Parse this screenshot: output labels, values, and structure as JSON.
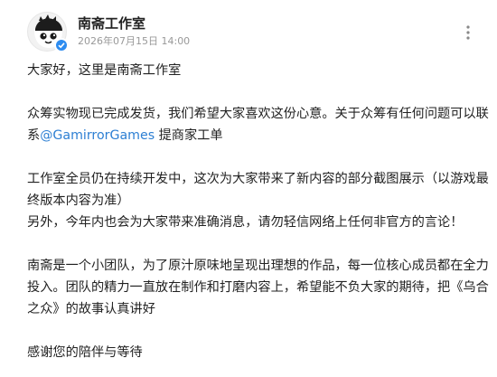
{
  "post": {
    "author": "南斋工作室",
    "date": "2026年07月15日 14:00",
    "greeting": "大家好，这里是南斋工作室",
    "p2_before": "众筹实物现已完成发货，我们希望大家喜欢这份心意。关于众筹有任何问题可以联系",
    "p2_mention": "@GamirrorGames",
    "p2_after": " 提商家工单",
    "p3_line1": "工作室全员仍在持续开发中，这次为大家带来了新内容的部分截图展示（以游戏最终版本内容为准）",
    "p3_line2": "另外，今年内也会为大家带来准确消息，请勿轻信网络上任何非官方的言论！",
    "p4": "南斋是一个小团队，为了原汁原味地呈现出理想的作品，每一位核心成员都在全力投入。团队的精力一直放在制作和打磨内容上，希望能不负大家的期待，把《乌合之众》的故事认真讲好",
    "closing": "感谢您的陪伴与等待"
  },
  "icons": {
    "avatar": "cartoon-face-avatar",
    "badge": "verified-badge-icon",
    "more": "more-vertical-icon"
  },
  "colors": {
    "mention": "#2d7fd3",
    "badge": "#2d8cf0",
    "date": "#999999"
  }
}
